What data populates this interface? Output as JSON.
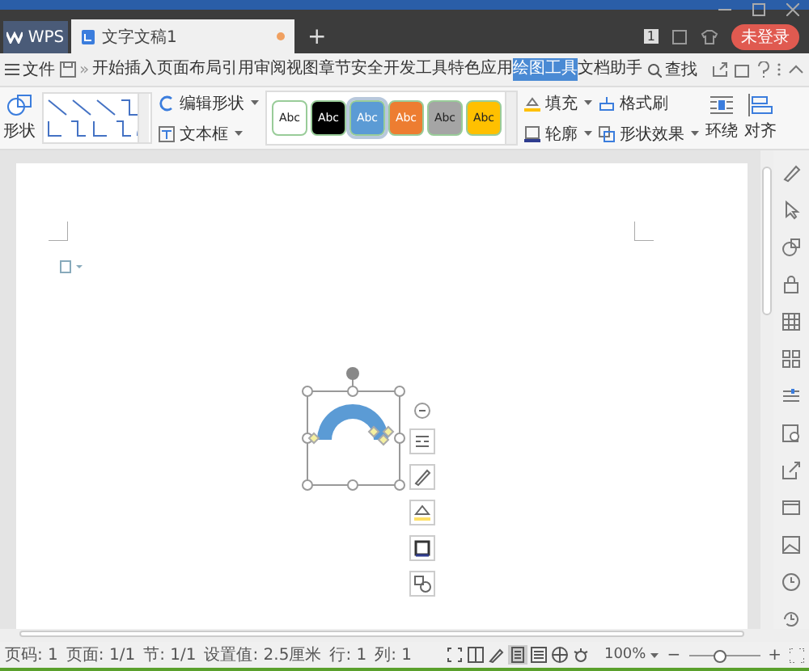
{
  "tabs": {
    "app": "WPS",
    "documents": [
      {
        "title": "文字文稿1",
        "selected": true,
        "modified": true
      }
    ],
    "new_tab": "+",
    "page_badge": "1",
    "login": "未登录"
  },
  "menu": {
    "file": "文件",
    "more": "»",
    "tabs": [
      {
        "label": "开始",
        "selected": false
      },
      {
        "label": "插入",
        "selected": false
      },
      {
        "label": "页面布局",
        "selected": false
      },
      {
        "label": "引用",
        "selected": false
      },
      {
        "label": "审阅",
        "selected": false
      },
      {
        "label": "视图",
        "selected": false
      },
      {
        "label": "章节",
        "selected": false
      },
      {
        "label": "安全",
        "selected": false
      },
      {
        "label": "开发工具",
        "selected": false
      },
      {
        "label": "特色应用",
        "selected": false
      },
      {
        "label": "绘图工具",
        "selected": true
      },
      {
        "label": "文档助手",
        "selected": false
      }
    ],
    "search": "查找"
  },
  "ribbon": {
    "shapes": "形状",
    "edit_shape": "编辑形状",
    "text_box": "文本框",
    "styles": [
      {
        "label": "Abc",
        "color": "#ffffff",
        "selected": false
      },
      {
        "label": "Abc",
        "color": "#000000",
        "selected": false
      },
      {
        "label": "Abc",
        "color": "#5b9bd5",
        "selected": true
      },
      {
        "label": "Abc",
        "color": "#ed7d31",
        "selected": false
      },
      {
        "label": "Abc",
        "color": "#a5a5a5",
        "selected": false
      },
      {
        "label": "Abc",
        "color": "#ffc000",
        "selected": false
      }
    ],
    "fill": "填充",
    "outline": "轮廓",
    "format_painter": "格式刷",
    "shape_effects": "形状效果",
    "wrap": "环绕",
    "align": "对齐"
  },
  "status_bar": {
    "fields": [
      "页码: 1",
      "页面: 1/1",
      "节: 1/1",
      "设置值: 2.5厘米",
      "行: 1",
      "列: 1"
    ],
    "views": [
      {
        "kind": "fullscreen",
        "selected": false
      },
      {
        "kind": "split",
        "selected": false
      },
      {
        "kind": "pen",
        "selected": false
      },
      {
        "kind": "page",
        "selected": true
      },
      {
        "kind": "outline",
        "selected": false
      },
      {
        "kind": "web",
        "selected": false
      },
      {
        "kind": "eye",
        "selected": false
      }
    ],
    "zoom": "100%",
    "zoom_out": "−",
    "zoom_slider": {
      "level": 0.45
    },
    "zoom_in": "+"
  }
}
